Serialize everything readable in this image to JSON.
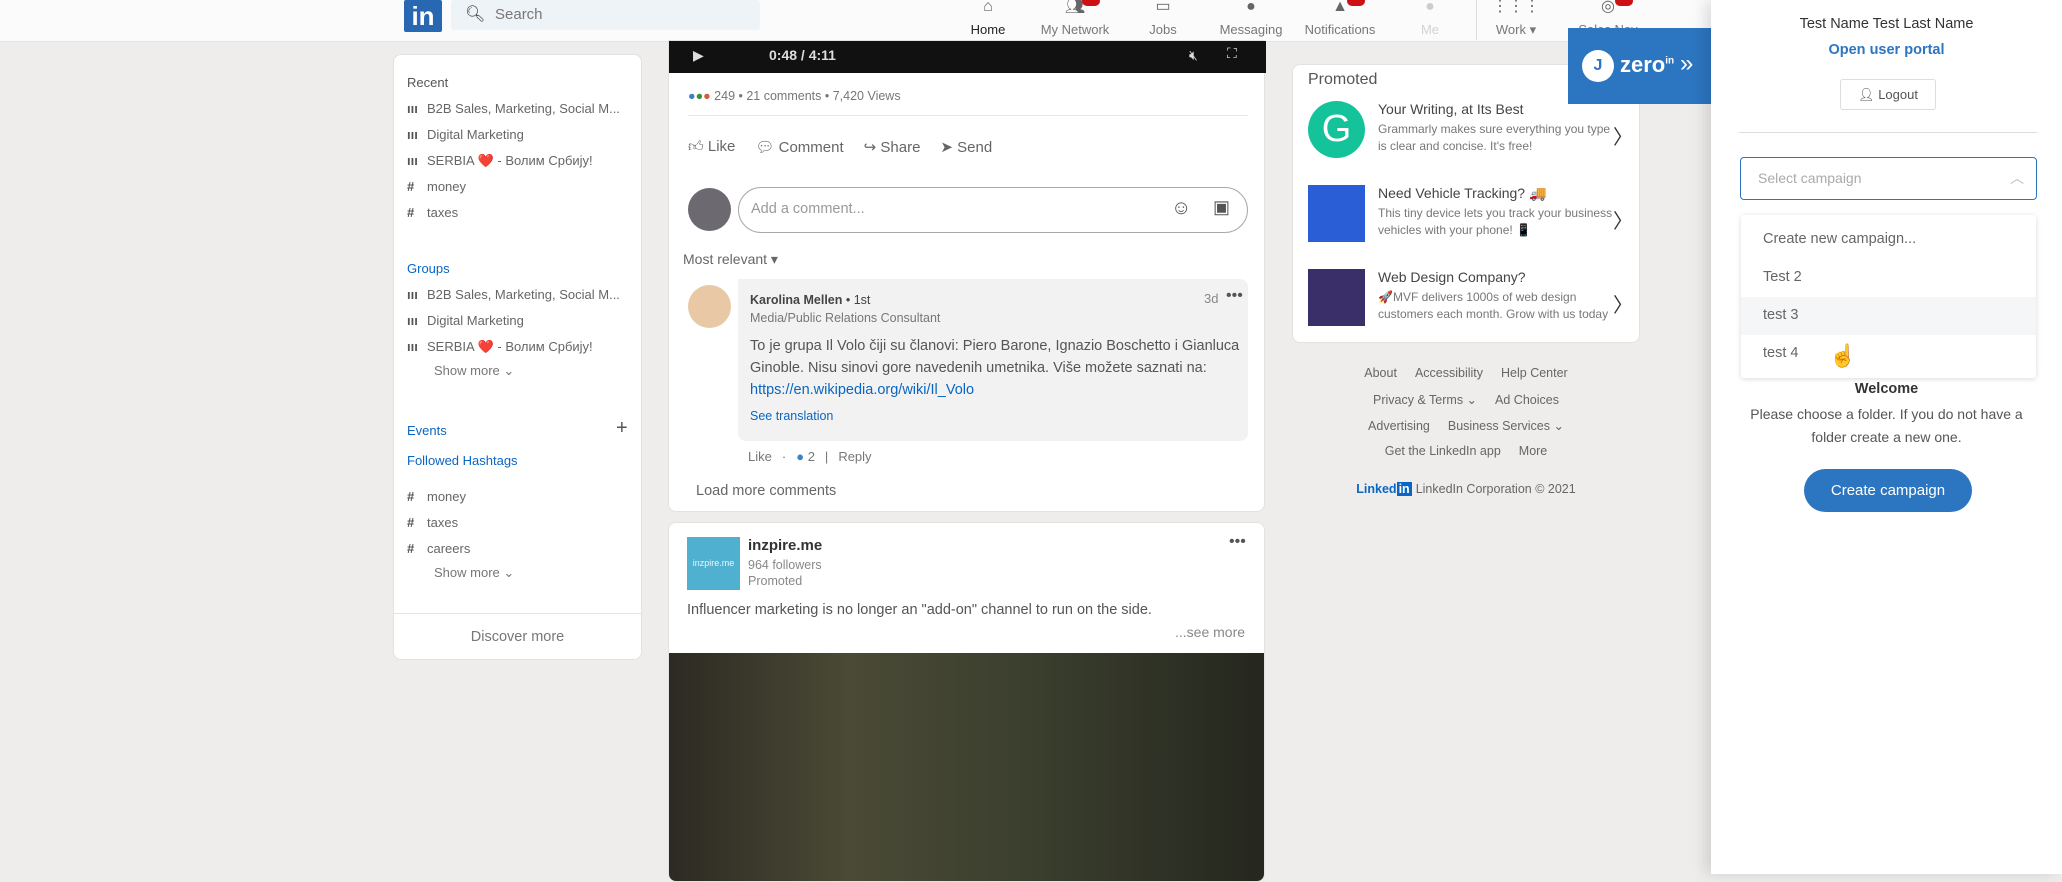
{
  "topnav": {
    "logo": "in",
    "search_placeholder": "Search",
    "items": [
      {
        "label": "Home",
        "icon": "home-icon"
      },
      {
        "label": "My Network",
        "icon": "network-icon"
      },
      {
        "label": "Jobs",
        "icon": "briefcase-icon"
      },
      {
        "label": "Messaging",
        "icon": "chat-icon"
      },
      {
        "label": "Notifications",
        "icon": "bell-icon"
      },
      {
        "label": "Me",
        "icon": "avatar-icon"
      },
      {
        "label": "Work",
        "icon": "grid-icon"
      },
      {
        "label": "Sales Nav",
        "icon": "compass-icon"
      }
    ]
  },
  "sidebar": {
    "recent_title": "Recent",
    "recent": [
      {
        "label": "B2B Sales, Marketing, Social M...",
        "icon": "group-icon"
      },
      {
        "label": "Digital Marketing",
        "icon": "group-icon"
      },
      {
        "label": "SERBIA ❤️ - Волим Србију!",
        "icon": "group-icon"
      },
      {
        "label": "money",
        "icon": "hashtag-icon"
      },
      {
        "label": "taxes",
        "icon": "hashtag-icon"
      }
    ],
    "groups_title": "Groups",
    "groups": [
      "B2B Sales, Marketing, Social M...",
      "Digital Marketing",
      "SERBIA ❤️ - Волим Србију!"
    ],
    "show_more": "Show more",
    "events_title": "Events",
    "hashtags_title": "Followed Hashtags",
    "hashtags": [
      "money",
      "taxes",
      "careers"
    ],
    "discover_more": "Discover more"
  },
  "post1": {
    "video_time": "0:48 / 4:11",
    "stats": "249 • 21 comments • 7,420 Views",
    "actions": [
      "Like",
      "Comment",
      "Share",
      "Send"
    ],
    "comment_placeholder": "Add a comment...",
    "sort": "Most relevant",
    "comment": {
      "author": "Karolina Mellen",
      "degree": "• 1st",
      "headline": "Media/Public Relations Consultant",
      "time": "3d",
      "text": "To je grupa Il Volo čiji su članovi: Piero Barone, Ignazio Boschetto i Gianluca Ginoble. Nisu sinovi gore navedenih umetnika. Više možete saznati na: ",
      "link": "https://en.wikipedia.org/wiki/Il_Volo",
      "translate": "See translation",
      "like": "Like",
      "likes": "2",
      "reply": "Reply"
    },
    "load_more": "Load more comments"
  },
  "post2": {
    "company": "inzpire.me",
    "logo_text": "inzpire.me",
    "followers": "964 followers",
    "promoted": "Promoted",
    "text": "Influencer marketing is no longer an \"add-on\" channel to run on the side.",
    "see_more": "...see more"
  },
  "promoted": {
    "title": "Promoted",
    "ads": [
      {
        "title": "Your Writing, at Its Best",
        "desc": "Grammarly makes sure everything you type is clear and concise. It's free!"
      },
      {
        "title": "Need Vehicle Tracking? 🚚",
        "desc": "This tiny device lets you track your business vehicles with your phone! 📱"
      },
      {
        "title": "Web Design Company?",
        "desc": "🚀MVF delivers 1000s of web design customers each month. Grow with us today"
      }
    ]
  },
  "footer": {
    "row1": [
      "About",
      "Accessibility",
      "Help Center"
    ],
    "row2": [
      "Privacy & Terms ⌄",
      "Ad Choices"
    ],
    "row3": [
      "Advertising",
      "Business Services ⌄"
    ],
    "row4": [
      "Get the LinkedIn app",
      "More"
    ],
    "brand": "Linked",
    "copyright": "LinkedIn Corporation © 2021"
  },
  "zeroin": {
    "brand": "zero",
    "sup": "in",
    "toggle": "»"
  },
  "panel": {
    "user": "Test Name Test Last Name",
    "portal": "Open user portal",
    "logout": "Logout",
    "select_placeholder": "Select campaign",
    "options": [
      "Create new campaign...",
      "Test 2",
      "test 3",
      "test 4"
    ],
    "hovered_option": "test 3",
    "welcome": "Welcome",
    "message": "Please choose a folder. If you do not have a folder create a new one.",
    "create": "Create campaign"
  },
  "colors": {
    "accent": "#2c75c1",
    "linkedin": "#0a66c2"
  }
}
